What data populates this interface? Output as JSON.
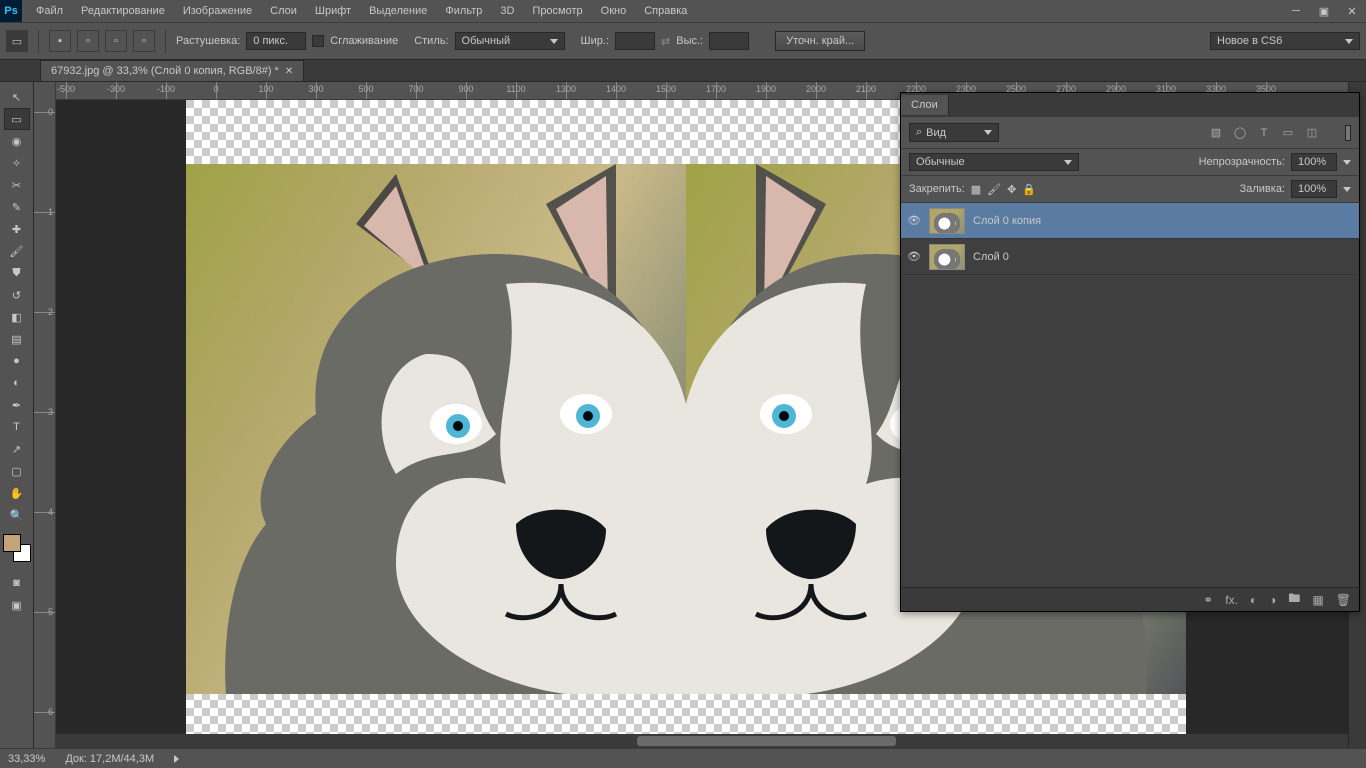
{
  "app": {
    "logo": "Ps"
  },
  "menu": [
    "Файл",
    "Редактирование",
    "Изображение",
    "Слои",
    "Шрифт",
    "Выделение",
    "Фильтр",
    "3D",
    "Просмотр",
    "Окно",
    "Справка"
  ],
  "optbar": {
    "feather_label": "Растушевка:",
    "feather_value": "0 пикс.",
    "antialias": "Сглаживание",
    "style_label": "Стиль:",
    "style_value": "Обычный",
    "width_label": "Шир.:",
    "height_label": "Выс.:",
    "refine": "Уточн. край...",
    "new_cs6": "Новое в CS6"
  },
  "doc": {
    "tab": "67932.jpg @ 33,3% (Слой 0 копия, RGB/8#) *"
  },
  "ruler_h": [
    -500,
    -300,
    -100,
    0,
    100,
    300,
    500,
    700,
    900,
    1100,
    1300,
    1400,
    1500,
    1700,
    1900,
    2000,
    2100,
    2200,
    2300,
    2500,
    2700,
    2900,
    3100,
    3300,
    3500
  ],
  "ruler_v": [
    0,
    1,
    2,
    3,
    4,
    5,
    6
  ],
  "layers": {
    "title": "Слои",
    "filter": "Вид",
    "blend": "Обычные",
    "opacity_label": "Непрозрачность:",
    "opacity_value": "100%",
    "lock_label": "Закрепить:",
    "fill_label": "Заливка:",
    "fill_value": "100%",
    "items": [
      {
        "name": "Слой 0 копия",
        "selected": true
      },
      {
        "name": "Слой 0",
        "selected": false
      }
    ]
  },
  "status": {
    "zoom": "33,33%",
    "doc": "Док: 17,2M/44,3M"
  },
  "icons": {
    "search": "⌕",
    "image": "▧",
    "circle": "◯",
    "text": "T",
    "box": "▭",
    "mask": "◫",
    "link": "⚭",
    "fx": "fx.",
    "new_mask": "◐",
    "adj": "◑",
    "folder": "🖿",
    "new": "▦",
    "trash": "🗑"
  }
}
